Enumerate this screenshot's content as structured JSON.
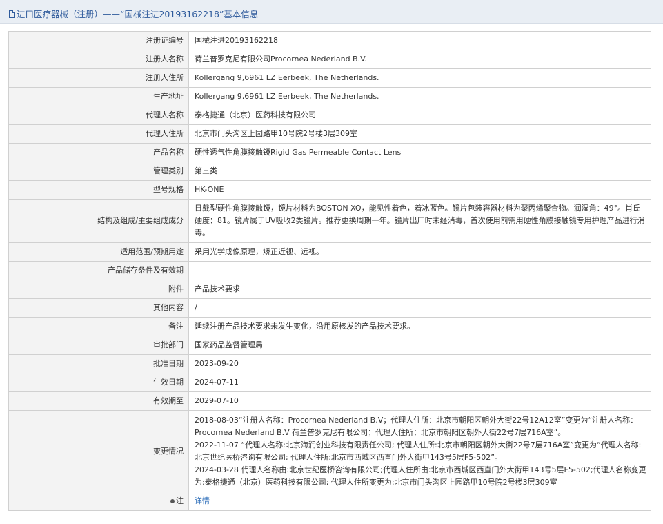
{
  "header": {
    "title": "进口医疗器械（注册）——“国械注进20193162218”基本信息"
  },
  "rows": [
    {
      "label": "注册证编号",
      "value": "国械注进20193162218"
    },
    {
      "label": "注册人名称",
      "value": "荷兰普罗克尼有限公司Procornea Nederland B.V."
    },
    {
      "label": "注册人住所",
      "value": "Kollergang 9,6961 LZ Eerbeek, The Netherlands."
    },
    {
      "label": "生产地址",
      "value": "Kollergang 9,6961 LZ Eerbeek, The Netherlands."
    },
    {
      "label": "代理人名称",
      "value": "泰格捷通（北京）医药科技有限公司"
    },
    {
      "label": "代理人住所",
      "value": "北京市门头沟区上园路甲10号院2号楼3层309室"
    },
    {
      "label": "产品名称",
      "value": "硬性透气性角膜接触镜Rigid Gas Permeable Contact Lens"
    },
    {
      "label": "管理类别",
      "value": "第三类"
    },
    {
      "label": "型号规格",
      "value": "HK-ONE"
    },
    {
      "label": "结构及组成/主要组成成分",
      "value": "日戴型硬性角膜接触镜，镜片材料为BOSTON XO，能见性着色，着冰蓝色。镜片包装容器材料为聚丙烯聚合物。润湿角：49°。肖氏硬度：81。镜片属于UV吸收2类镜片。推荐更换周期一年。镜片出厂时未经消毒，首次使用前需用硬性角膜接触镜专用护理产品进行消毒。"
    },
    {
      "label": "适用范围/预期用途",
      "value": "采用光学成像原理，矫正近视、远视。"
    },
    {
      "label": "产品储存条件及有效期",
      "value": ""
    },
    {
      "label": "附件",
      "value": "产品技术要求"
    },
    {
      "label": "其他内容",
      "value": "/"
    },
    {
      "label": "备注",
      "value": "延续注册产品技术要求未发生变化，沿用原核发的产品技术要求。"
    },
    {
      "label": "审批部门",
      "value": "国家药品监督管理局"
    },
    {
      "label": "批准日期",
      "value": "2023-09-20"
    },
    {
      "label": "生效日期",
      "value": "2024-07-11"
    },
    {
      "label": "有效期至",
      "value": "2029-07-10"
    }
  ],
  "changes": {
    "label": "变更情况",
    "entries": [
      "2018-08-03“注册人名称：Procornea Nederland B.V；代理人住所：北京市朝阳区朝外大街22号12A12室”变更为“注册人名称：Procornea Nederland B.V 荷兰普罗克尼有限公司；代理人住所：北京市朝阳区朝外大街22号7层716A室”。",
      "2022-11-07 “代理人名称:北京海润创业科技有限责任公司; 代理人住所:北京市朝阳区朝外大街22号7层716A室”变更为“代理人名称:北京世纪医桥咨询有限公司; 代理人住所:北京市西城区西直门外大街甲143号5层F5-502”。",
      "2024-03-28 代理人名称由:北京世纪医桥咨询有限公司;代理人住所由:北京市西城区西直门外大街甲143号5层F5-502;代理人名称变更为:泰格捷通（北京）医药科技有限公司; 代理人住所变更为:北京市门头沟区上园路甲10号院2号楼3层309室"
    ]
  },
  "note": {
    "label": "注",
    "icon": "pin-icon",
    "link_text": "详情",
    "link_color": "#2f6fba"
  }
}
